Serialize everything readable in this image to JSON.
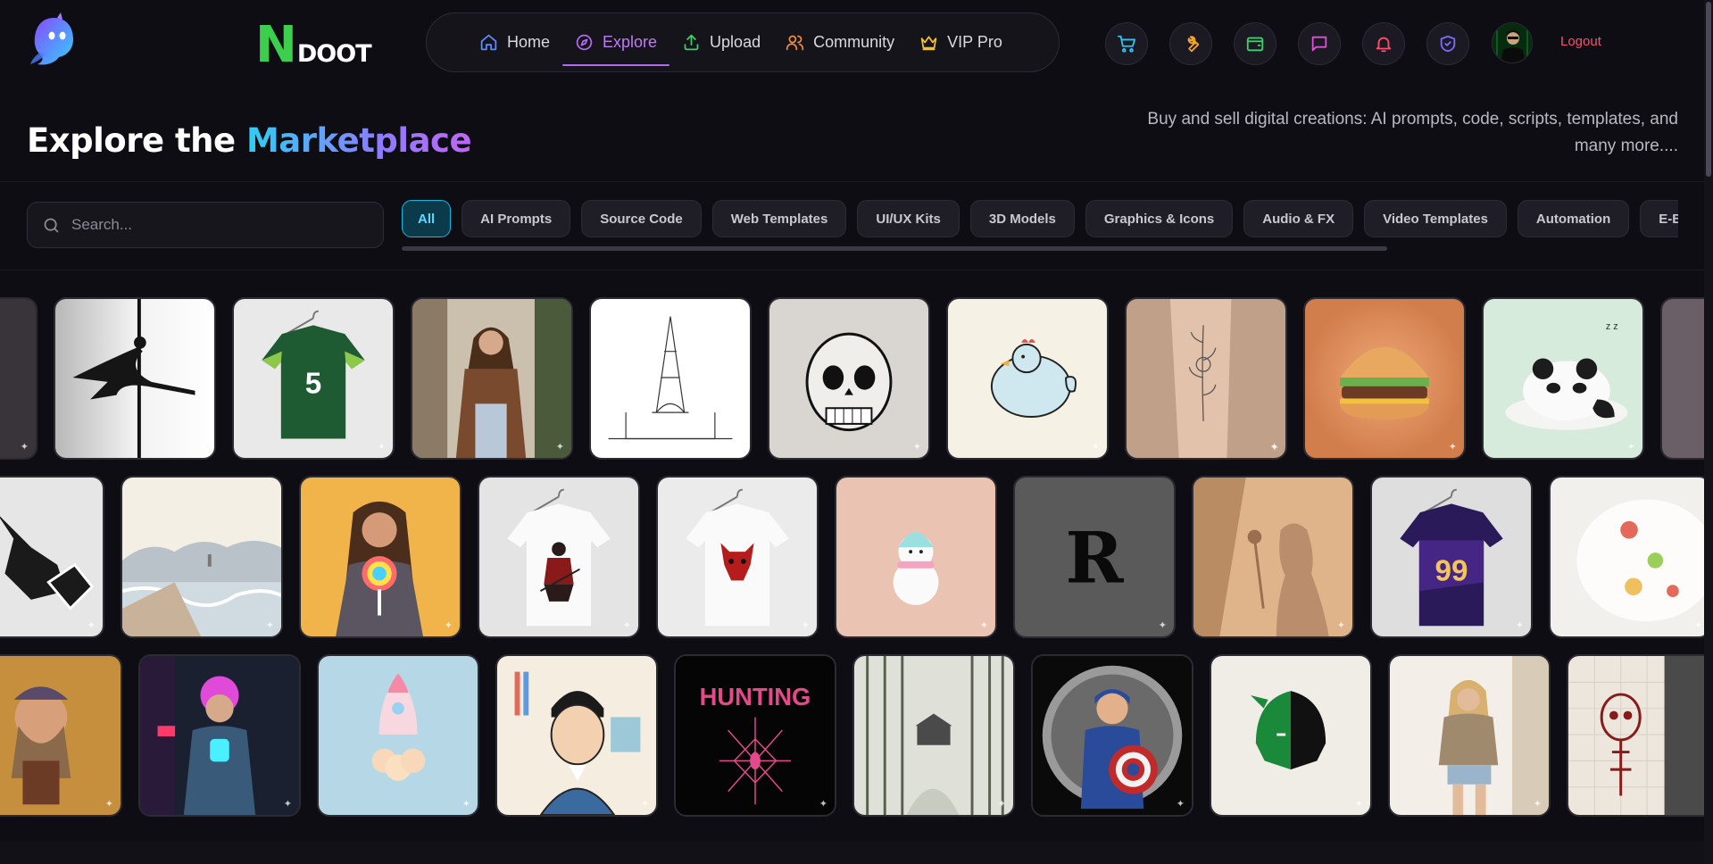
{
  "brand": {
    "letter": "N",
    "word": "DOOT"
  },
  "nav": {
    "items": [
      {
        "label": "Home",
        "icon": "home-icon",
        "active": false
      },
      {
        "label": "Explore",
        "icon": "compass-icon",
        "active": true
      },
      {
        "label": "Upload",
        "icon": "upload-icon",
        "active": false
      },
      {
        "label": "Community",
        "icon": "users-icon",
        "active": false
      },
      {
        "label": "VIP Pro",
        "icon": "crown-icon",
        "active": false
      }
    ]
  },
  "toolbar": {
    "icons": [
      "cart-icon",
      "wrench-icon",
      "wallet-icon",
      "chat-icon",
      "bell-icon",
      "shield-icon"
    ],
    "logout_label": "Logout"
  },
  "hero": {
    "title_plain": "Explore the ",
    "title_highlight": "Marketplace",
    "tagline": "Buy and sell digital creations: AI prompts, code, scripts, templates, and many more...."
  },
  "search": {
    "placeholder": "Search...",
    "value": ""
  },
  "categories": [
    "All",
    "AI Prompts",
    "Source Code",
    "Web Templates",
    "UI/UX Kits",
    "3D Models",
    "Graphics & Icons",
    "Audio & FX",
    "Video Templates",
    "Automation",
    "E-Books"
  ],
  "active_category": "All",
  "gallery": {
    "rows": [
      [
        "pole dancer silhouette",
        "green football jersey number 5",
        "woman mirror selfie",
        "Eiffel Tower line sketch",
        "skull chest tattoo",
        "cute bird illustration",
        "floral forearm tattoo",
        "3D burger render",
        "sleeping panda toy"
      ],
      [
        "viking helmet graphic",
        "watercolor seascape",
        "woman with lollipop",
        "samurai t-shirt",
        "demon t-shirt",
        "snowman toy",
        "gothic letter R",
        "woman silhouette with rose",
        "purple jersey number 99",
        "food plate"
      ],
      [
        "dwarf figurine",
        "neon cyberpunk woman",
        "toy rocket",
        "man cartoon portrait",
        "HUNTING spider logo",
        "bamboo forest ink painting",
        "Captain America coin",
        "dragon knight logo",
        "woman mirror photo",
        "skull tattoo design"
      ]
    ],
    "hunting_text": "HUNTING",
    "gothic_letter": "R",
    "jersey_numbers": [
      "5",
      "99"
    ]
  },
  "colors": {
    "accent": "#b26bf0",
    "chip_active": "#18b6e0",
    "logout": "#ff4d6d",
    "brand_green": "#3ccf4e"
  }
}
